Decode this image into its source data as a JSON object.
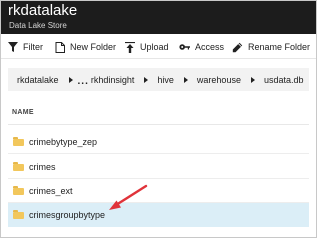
{
  "header": {
    "title": "rkdatalake",
    "subtitle": "Data Lake Store"
  },
  "toolbar": {
    "filter_label": "Filter",
    "new_folder_label": "New Folder",
    "upload_label": "Upload",
    "access_label": "Access",
    "rename_folder_label": "Rename Folder"
  },
  "breadcrumb": {
    "items": [
      "rkdatalake",
      "rkhdinsight",
      "hive",
      "warehouse",
      "usdata.db"
    ],
    "overflow": "..."
  },
  "table": {
    "column_name": "NAME",
    "rows": [
      "crimebytype_zep",
      "crimes",
      "crimes_ext",
      "crimesgroupbytype"
    ],
    "selected_row": "crimesgroupbytype"
  },
  "colors": {
    "header_bg": "#1c1c1c",
    "selected_row_bg": "#dbeef7",
    "folder_color": "#f2c75c",
    "arrow_color": "#e0333a"
  },
  "icons": [
    "filter-icon",
    "new-folder-icon",
    "upload-icon",
    "access-icon",
    "rename-icon",
    "folder-icon",
    "arrow-annotation"
  ]
}
